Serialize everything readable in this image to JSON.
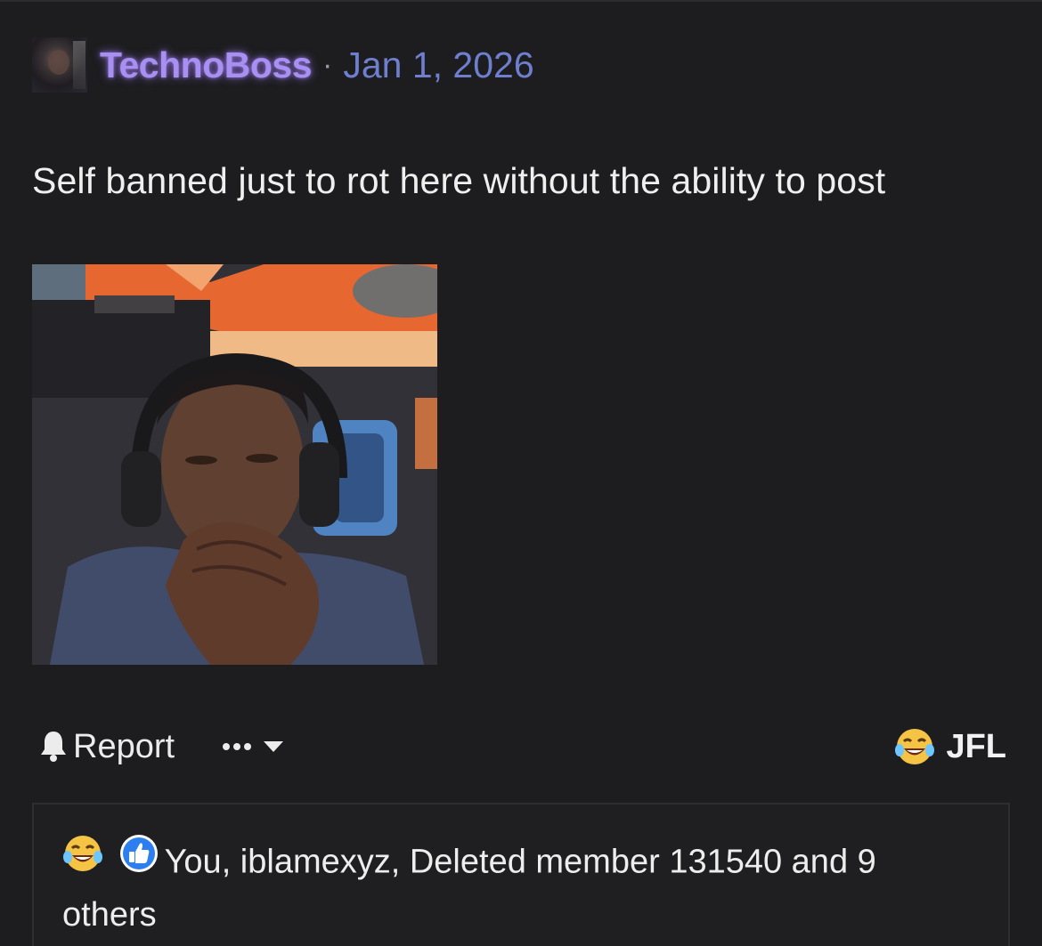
{
  "post": {
    "author": "TechnoBoss",
    "separator": "·",
    "date": "Jan 1, 2026",
    "message": "Self banned just to rot here without the ability to post"
  },
  "actions": {
    "report_label": "Report",
    "more_label": "•••",
    "reaction_label": "JFL"
  },
  "reactions_summary": {
    "text": "You, iblamexyz, Deleted member 131540 and 9 others"
  },
  "icons": {
    "avatar": "user-avatar",
    "report": "bell-icon",
    "more": "ellipsis-icon",
    "dropdown": "caret-down-icon",
    "reaction": "laughing-crying-emoji-icon",
    "like": "thumbs-up-icon"
  },
  "colors": {
    "background": "#1d1d1f",
    "username": "#a88ff2",
    "date": "#6f7fd0",
    "text": "#efefef",
    "like_badge": "#2d7ff0"
  }
}
